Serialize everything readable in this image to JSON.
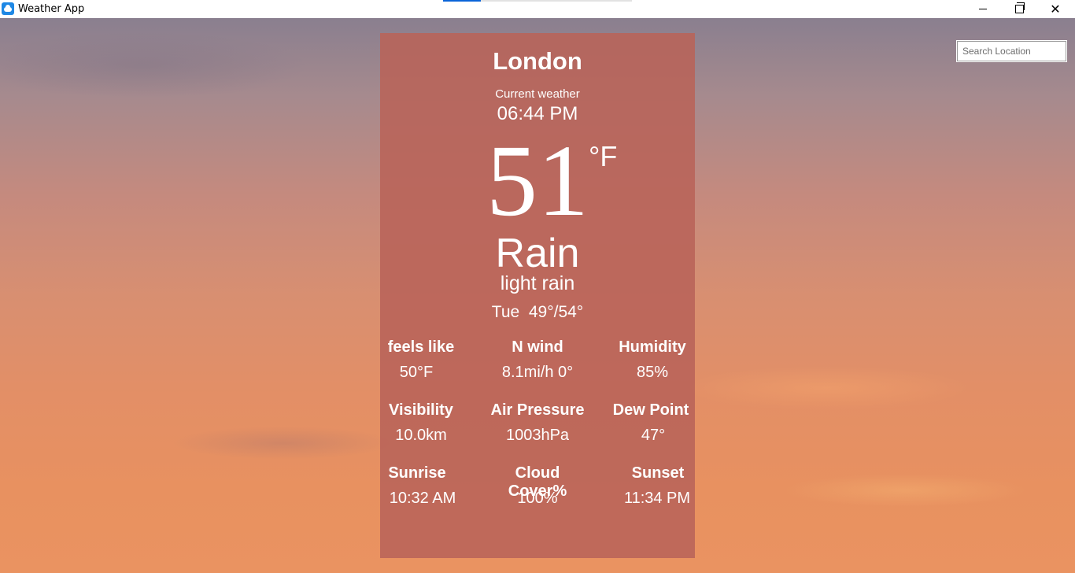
{
  "window": {
    "title": "Weather App",
    "app_icon": "weather-cloud-icon",
    "minimize_icon": "minimize-icon",
    "maximize_icon": "restore-icon",
    "close_icon": "close-icon",
    "close_glyph": "✕"
  },
  "search": {
    "placeholder": "Search Location",
    "value": ""
  },
  "weather": {
    "city": "London",
    "label": "Current weather",
    "time": "06:44 PM",
    "temperature": "51",
    "unit": "°F",
    "condition": "Rain",
    "description": "light rain",
    "day_range": "Tue  49°/54°",
    "stats": [
      {
        "label": "feels like",
        "value": "50°F"
      },
      {
        "label": "N wind",
        "value": "8.1mi/h 0°"
      },
      {
        "label": "Humidity",
        "value": "85%"
      },
      {
        "label": "Visibility",
        "value": "10.0km"
      },
      {
        "label": "Air Pressure",
        "value": "1003hPa"
      },
      {
        "label": "Dew Point",
        "value": "47°"
      },
      {
        "label": "Sunrise",
        "value": "10:32 AM"
      },
      {
        "label": "Cloud Cover%",
        "value": "100%"
      },
      {
        "label": "Sunset",
        "value": "11:34 PM"
      }
    ]
  },
  "colors": {
    "card": "#b86359",
    "accent_tab": "#0a64d8"
  }
}
